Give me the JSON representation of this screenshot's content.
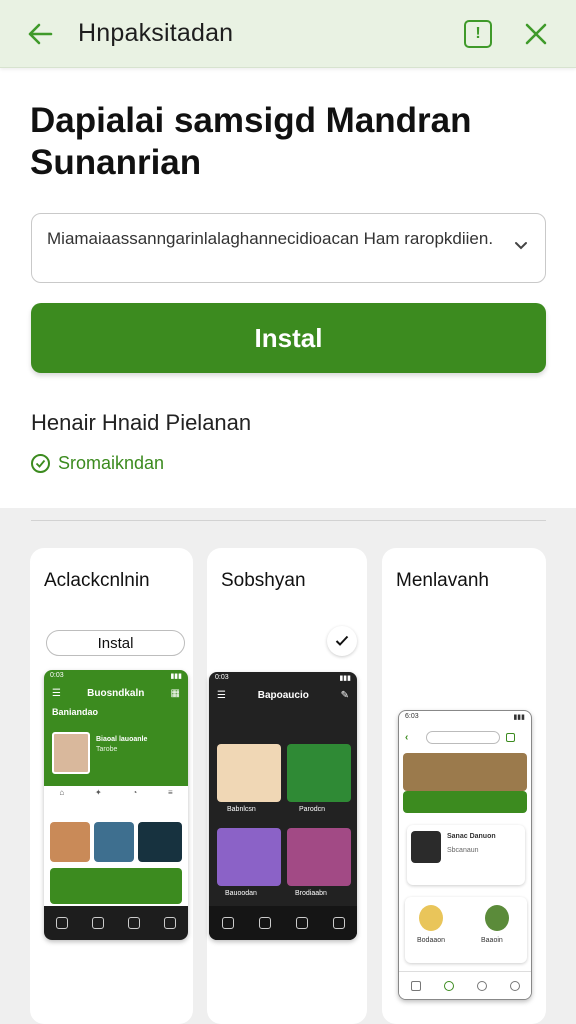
{
  "header": {
    "title": "Hnpaksitadan",
    "back_icon": "arrow-left-icon",
    "info_icon": "info-box-icon",
    "info_glyph": "!",
    "close_icon": "close-icon"
  },
  "main": {
    "heading": "Dapialai samsigd Mandran Sunanrian",
    "select_text": "Miamaiaassanngarinlalaghannecidioacan Ham raropkdiien.",
    "install_label": "Instal",
    "sub_label": "Henair Hnaid Pielanan",
    "status_text": "Sromaikndan"
  },
  "gallery": {
    "cards": [
      {
        "title": "Aclackcnlnin",
        "button_label": "Instal"
      },
      {
        "title": "Sobshyan"
      },
      {
        "title": "Menlavanh"
      }
    ],
    "phone1": {
      "time": "0:03",
      "app_title": "Buosndkaln",
      "section": "Baniandao",
      "profile_line1": "Biaoal lauoanle",
      "profile_line2": "Tarobe"
    },
    "phone2": {
      "time": "0:03",
      "app_title": "Bapoaucio",
      "tile1_label": "Babnlcsn",
      "tile2_label": "Parodcn",
      "tile3_label": "Bauoodan",
      "tile4_label": "Brodiaabn"
    },
    "phone3": {
      "time": "6:03",
      "item_title": "Sanac Danuon",
      "item_sub": "Sbcanaun",
      "item2_label": "Bodaaon",
      "item3_label": "Baaoin"
    }
  },
  "colors": {
    "accent": "#3c8b1f",
    "topbar_bg": "#e9f2e3",
    "gallery_bg": "#efefef"
  }
}
